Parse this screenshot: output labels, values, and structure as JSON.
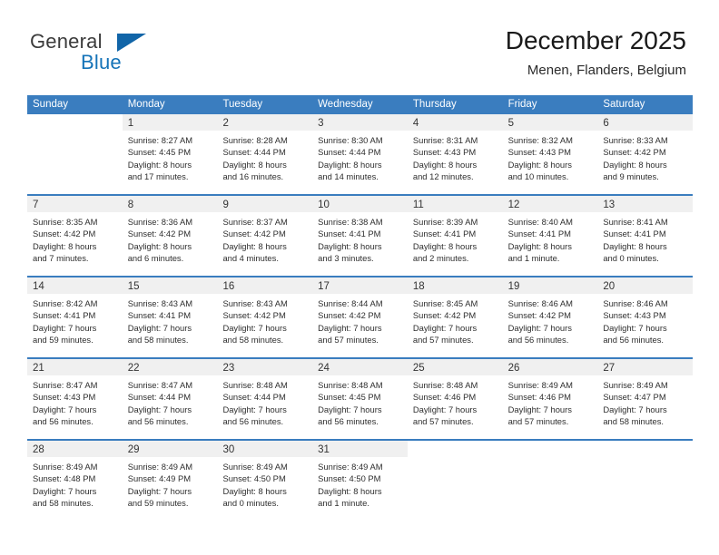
{
  "brand": {
    "word_one": "General",
    "word_two": "Blue",
    "triangle_color": "#1165a8",
    "blue_text_color": "#1473b8"
  },
  "header": {
    "title": "December 2025",
    "subtitle": "Menen, Flanders, Belgium"
  },
  "theme": {
    "header_blue": "#3a7dbf",
    "day_band_gray": "#f0f0f0",
    "text_color": "#2e2e2e"
  },
  "weekdays": [
    "Sunday",
    "Monday",
    "Tuesday",
    "Wednesday",
    "Thursday",
    "Friday",
    "Saturday"
  ],
  "weeks": [
    [
      {
        "day": "",
        "lines": []
      },
      {
        "day": "1",
        "lines": [
          "Sunrise: 8:27 AM",
          "Sunset: 4:45 PM",
          "Daylight: 8 hours",
          "and 17 minutes."
        ]
      },
      {
        "day": "2",
        "lines": [
          "Sunrise: 8:28 AM",
          "Sunset: 4:44 PM",
          "Daylight: 8 hours",
          "and 16 minutes."
        ]
      },
      {
        "day": "3",
        "lines": [
          "Sunrise: 8:30 AM",
          "Sunset: 4:44 PM",
          "Daylight: 8 hours",
          "and 14 minutes."
        ]
      },
      {
        "day": "4",
        "lines": [
          "Sunrise: 8:31 AM",
          "Sunset: 4:43 PM",
          "Daylight: 8 hours",
          "and 12 minutes."
        ]
      },
      {
        "day": "5",
        "lines": [
          "Sunrise: 8:32 AM",
          "Sunset: 4:43 PM",
          "Daylight: 8 hours",
          "and 10 minutes."
        ]
      },
      {
        "day": "6",
        "lines": [
          "Sunrise: 8:33 AM",
          "Sunset: 4:42 PM",
          "Daylight: 8 hours",
          "and 9 minutes."
        ]
      }
    ],
    [
      {
        "day": "7",
        "lines": [
          "Sunrise: 8:35 AM",
          "Sunset: 4:42 PM",
          "Daylight: 8 hours",
          "and 7 minutes."
        ]
      },
      {
        "day": "8",
        "lines": [
          "Sunrise: 8:36 AM",
          "Sunset: 4:42 PM",
          "Daylight: 8 hours",
          "and 6 minutes."
        ]
      },
      {
        "day": "9",
        "lines": [
          "Sunrise: 8:37 AM",
          "Sunset: 4:42 PM",
          "Daylight: 8 hours",
          "and 4 minutes."
        ]
      },
      {
        "day": "10",
        "lines": [
          "Sunrise: 8:38 AM",
          "Sunset: 4:41 PM",
          "Daylight: 8 hours",
          "and 3 minutes."
        ]
      },
      {
        "day": "11",
        "lines": [
          "Sunrise: 8:39 AM",
          "Sunset: 4:41 PM",
          "Daylight: 8 hours",
          "and 2 minutes."
        ]
      },
      {
        "day": "12",
        "lines": [
          "Sunrise: 8:40 AM",
          "Sunset: 4:41 PM",
          "Daylight: 8 hours",
          "and 1 minute."
        ]
      },
      {
        "day": "13",
        "lines": [
          "Sunrise: 8:41 AM",
          "Sunset: 4:41 PM",
          "Daylight: 8 hours",
          "and 0 minutes."
        ]
      }
    ],
    [
      {
        "day": "14",
        "lines": [
          "Sunrise: 8:42 AM",
          "Sunset: 4:41 PM",
          "Daylight: 7 hours",
          "and 59 minutes."
        ]
      },
      {
        "day": "15",
        "lines": [
          "Sunrise: 8:43 AM",
          "Sunset: 4:41 PM",
          "Daylight: 7 hours",
          "and 58 minutes."
        ]
      },
      {
        "day": "16",
        "lines": [
          "Sunrise: 8:43 AM",
          "Sunset: 4:42 PM",
          "Daylight: 7 hours",
          "and 58 minutes."
        ]
      },
      {
        "day": "17",
        "lines": [
          "Sunrise: 8:44 AM",
          "Sunset: 4:42 PM",
          "Daylight: 7 hours",
          "and 57 minutes."
        ]
      },
      {
        "day": "18",
        "lines": [
          "Sunrise: 8:45 AM",
          "Sunset: 4:42 PM",
          "Daylight: 7 hours",
          "and 57 minutes."
        ]
      },
      {
        "day": "19",
        "lines": [
          "Sunrise: 8:46 AM",
          "Sunset: 4:42 PM",
          "Daylight: 7 hours",
          "and 56 minutes."
        ]
      },
      {
        "day": "20",
        "lines": [
          "Sunrise: 8:46 AM",
          "Sunset: 4:43 PM",
          "Daylight: 7 hours",
          "and 56 minutes."
        ]
      }
    ],
    [
      {
        "day": "21",
        "lines": [
          "Sunrise: 8:47 AM",
          "Sunset: 4:43 PM",
          "Daylight: 7 hours",
          "and 56 minutes."
        ]
      },
      {
        "day": "22",
        "lines": [
          "Sunrise: 8:47 AM",
          "Sunset: 4:44 PM",
          "Daylight: 7 hours",
          "and 56 minutes."
        ]
      },
      {
        "day": "23",
        "lines": [
          "Sunrise: 8:48 AM",
          "Sunset: 4:44 PM",
          "Daylight: 7 hours",
          "and 56 minutes."
        ]
      },
      {
        "day": "24",
        "lines": [
          "Sunrise: 8:48 AM",
          "Sunset: 4:45 PM",
          "Daylight: 7 hours",
          "and 56 minutes."
        ]
      },
      {
        "day": "25",
        "lines": [
          "Sunrise: 8:48 AM",
          "Sunset: 4:46 PM",
          "Daylight: 7 hours",
          "and 57 minutes."
        ]
      },
      {
        "day": "26",
        "lines": [
          "Sunrise: 8:49 AM",
          "Sunset: 4:46 PM",
          "Daylight: 7 hours",
          "and 57 minutes."
        ]
      },
      {
        "day": "27",
        "lines": [
          "Sunrise: 8:49 AM",
          "Sunset: 4:47 PM",
          "Daylight: 7 hours",
          "and 58 minutes."
        ]
      }
    ],
    [
      {
        "day": "28",
        "lines": [
          "Sunrise: 8:49 AM",
          "Sunset: 4:48 PM",
          "Daylight: 7 hours",
          "and 58 minutes."
        ]
      },
      {
        "day": "29",
        "lines": [
          "Sunrise: 8:49 AM",
          "Sunset: 4:49 PM",
          "Daylight: 7 hours",
          "and 59 minutes."
        ]
      },
      {
        "day": "30",
        "lines": [
          "Sunrise: 8:49 AM",
          "Sunset: 4:50 PM",
          "Daylight: 8 hours",
          "and 0 minutes."
        ]
      },
      {
        "day": "31",
        "lines": [
          "Sunrise: 8:49 AM",
          "Sunset: 4:50 PM",
          "Daylight: 8 hours",
          "and 1 minute."
        ]
      },
      {
        "day": "",
        "lines": []
      },
      {
        "day": "",
        "lines": []
      },
      {
        "day": "",
        "lines": []
      }
    ]
  ]
}
